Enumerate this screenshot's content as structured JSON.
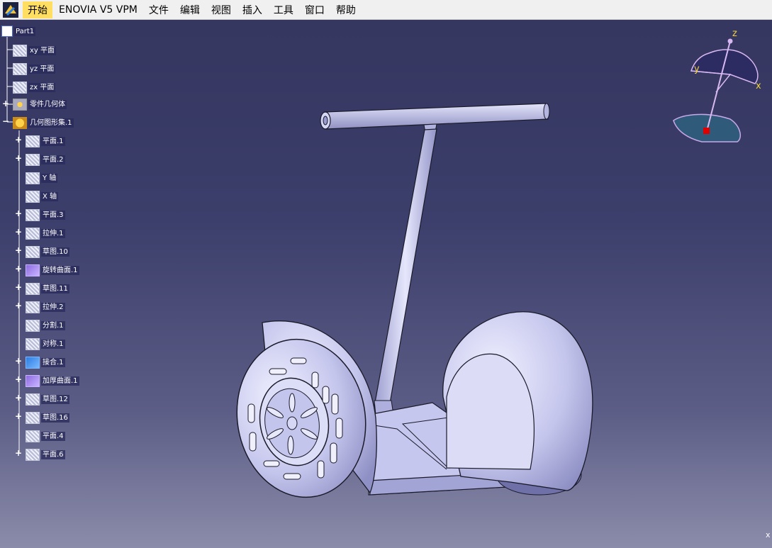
{
  "menubar": {
    "items": [
      {
        "label": "开始",
        "active": true
      },
      {
        "label": "ENOVIA V5 VPM"
      },
      {
        "label": "文件"
      },
      {
        "label": "编辑"
      },
      {
        "label": "视图"
      },
      {
        "label": "插入"
      },
      {
        "label": "工具"
      },
      {
        "label": "窗口"
      },
      {
        "label": "帮助"
      }
    ]
  },
  "tree": {
    "root": "Part1",
    "planes": [
      "xy 平面",
      "yz 平面",
      "zx 平面"
    ],
    "part_body": "零件几何体",
    "geo_set": "几何图形集.1",
    "children": [
      "平面.1",
      "平面.2",
      "Y 轴",
      "X 轴",
      "平面.3",
      "拉伸.1",
      "草图.10",
      "旋转曲面.1",
      "草图.11",
      "拉伸.2",
      "分割.1",
      "对称.1",
      "接合.1",
      "加厚曲面.1",
      "草图.12",
      "草图.16",
      "平面.4",
      "平面.6"
    ]
  },
  "compass": {
    "axis_x": "x",
    "axis_y": "y",
    "axis_z": "z"
  },
  "colors": {
    "menu_active": "#ffde62",
    "background_top": "#34365f",
    "background_bottom": "#8b8caa",
    "model_surface": "#c8c9ee",
    "compass_base": "#2f5a7a",
    "compass_origin": "#e00000"
  },
  "status_corner": "x"
}
